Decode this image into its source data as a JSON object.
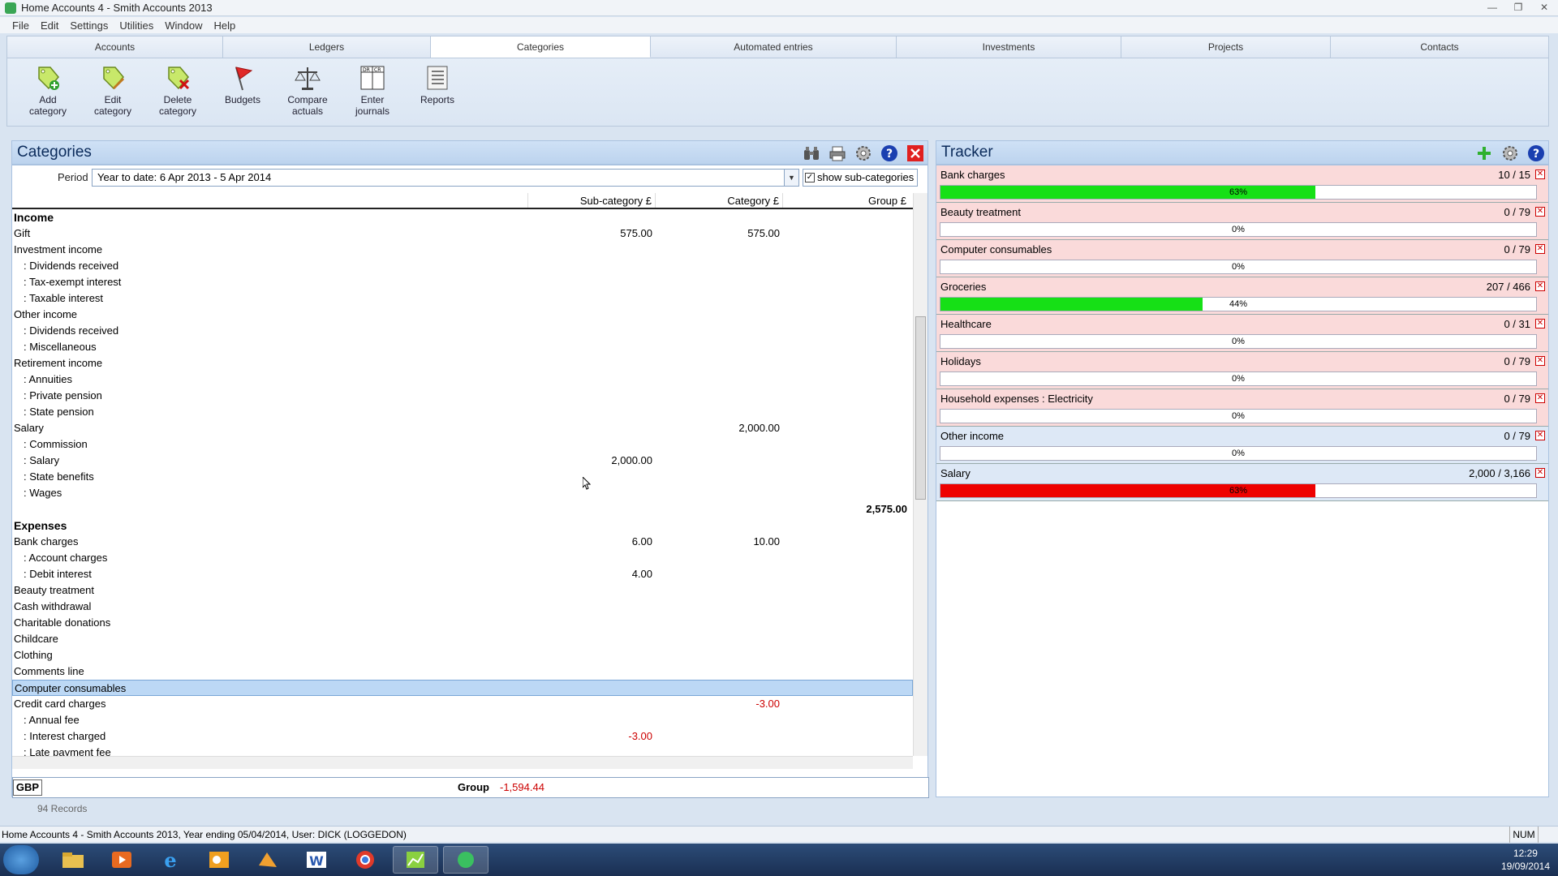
{
  "window": {
    "title": "Home Accounts 4 - Smith Accounts 2013"
  },
  "menu": [
    "File",
    "Edit",
    "Settings",
    "Utilities",
    "Window",
    "Help"
  ],
  "tabs": [
    {
      "label": "Accounts",
      "active": false
    },
    {
      "label": "Ledgers",
      "active": false
    },
    {
      "label": "Categories",
      "active": true
    },
    {
      "label": "Automated entries",
      "active": false
    },
    {
      "label": "Investments",
      "active": false
    },
    {
      "label": "Projects",
      "active": false
    },
    {
      "label": "Contacts",
      "active": false
    }
  ],
  "tools": [
    {
      "line1": "Add",
      "line2": "category",
      "icon": "add-tag-icon"
    },
    {
      "line1": "Edit",
      "line2": "category",
      "icon": "edit-tag-icon"
    },
    {
      "line1": "Delete",
      "line2": "category",
      "icon": "delete-tag-icon"
    },
    {
      "line1": "Budgets",
      "line2": "",
      "icon": "flag-icon"
    },
    {
      "line1": "Compare",
      "line2": "actuals",
      "icon": "scales-icon"
    },
    {
      "line1": "Enter",
      "line2": "journals",
      "icon": "journal-icon"
    },
    {
      "line1": "Reports",
      "line2": "",
      "icon": "report-icon"
    }
  ],
  "categories": {
    "title": "Categories",
    "period_label": "Period",
    "period_value": "Year to date: 6 Apr 2013 - 5 Apr 2014",
    "show_sub_label": "show sub-categories",
    "show_sub_checked": true,
    "columns": [
      "Sub-category £",
      "Category £",
      "Group £"
    ],
    "rows": [
      {
        "name": "Income",
        "type": "section",
        "sub": "",
        "cat": "",
        "grp": ""
      },
      {
        "name": "Gift",
        "type": "cat",
        "sub": "575.00",
        "cat": "575.00",
        "grp": ""
      },
      {
        "name": "Investment income",
        "type": "cat",
        "sub": "",
        "cat": "",
        "grp": ""
      },
      {
        "name": ": Dividends received",
        "type": "sub",
        "sub": "",
        "cat": "",
        "grp": ""
      },
      {
        "name": ": Tax-exempt interest",
        "type": "sub",
        "sub": "",
        "cat": "",
        "grp": ""
      },
      {
        "name": ": Taxable interest",
        "type": "sub",
        "sub": "",
        "cat": "",
        "grp": ""
      },
      {
        "name": "Other income",
        "type": "cat",
        "sub": "",
        "cat": "",
        "grp": ""
      },
      {
        "name": ": Dividends received",
        "type": "sub",
        "sub": "",
        "cat": "",
        "grp": ""
      },
      {
        "name": ": Miscellaneous",
        "type": "sub",
        "sub": "",
        "cat": "",
        "grp": ""
      },
      {
        "name": "Retirement income",
        "type": "cat",
        "sub": "",
        "cat": "",
        "grp": ""
      },
      {
        "name": ": Annuities",
        "type": "sub",
        "sub": "",
        "cat": "",
        "grp": ""
      },
      {
        "name": ": Private pension",
        "type": "sub",
        "sub": "",
        "cat": "",
        "grp": ""
      },
      {
        "name": ": State pension",
        "type": "sub",
        "sub": "",
        "cat": "",
        "grp": ""
      },
      {
        "name": "Salary",
        "type": "cat",
        "sub": "",
        "cat": "2,000.00",
        "grp": ""
      },
      {
        "name": ": Commission",
        "type": "sub",
        "sub": "",
        "cat": "",
        "grp": ""
      },
      {
        "name": ": Salary",
        "type": "sub",
        "sub": "2,000.00",
        "cat": "",
        "grp": ""
      },
      {
        "name": ": State benefits",
        "type": "sub",
        "sub": "",
        "cat": "",
        "grp": ""
      },
      {
        "name": ": Wages",
        "type": "sub",
        "sub": "",
        "cat": "",
        "grp": ""
      },
      {
        "name": "",
        "type": "total",
        "sub": "",
        "cat": "",
        "grp": "2,575.00"
      },
      {
        "name": "Expenses",
        "type": "section",
        "sub": "",
        "cat": "",
        "grp": ""
      },
      {
        "name": "Bank charges",
        "type": "cat",
        "sub": "6.00",
        "cat": "10.00",
        "grp": ""
      },
      {
        "name": ": Account charges",
        "type": "sub",
        "sub": "",
        "cat": "",
        "grp": ""
      },
      {
        "name": ": Debit interest",
        "type": "sub",
        "sub": "4.00",
        "cat": "",
        "grp": ""
      },
      {
        "name": "Beauty treatment",
        "type": "cat",
        "sub": "",
        "cat": "",
        "grp": ""
      },
      {
        "name": "Cash withdrawal",
        "type": "cat",
        "sub": "",
        "cat": "",
        "grp": ""
      },
      {
        "name": "Charitable donations",
        "type": "cat",
        "sub": "",
        "cat": "",
        "grp": ""
      },
      {
        "name": "Childcare",
        "type": "cat",
        "sub": "",
        "cat": "",
        "grp": ""
      },
      {
        "name": "Clothing",
        "type": "cat",
        "sub": "",
        "cat": "",
        "grp": ""
      },
      {
        "name": "Comments line",
        "type": "cat",
        "sub": "",
        "cat": "",
        "grp": ""
      },
      {
        "name": "Computer consumables",
        "type": "selected",
        "sub": "",
        "cat": "",
        "grp": ""
      },
      {
        "name": "Credit card charges",
        "type": "cat",
        "sub": "",
        "cat": "-3.00",
        "grp": ""
      },
      {
        "name": ": Annual fee",
        "type": "sub",
        "sub": "",
        "cat": "",
        "grp": ""
      },
      {
        "name": ": Interest charged",
        "type": "sub",
        "sub": "-3.00",
        "cat": "",
        "grp": ""
      },
      {
        "name": ": Late payment fee",
        "type": "sub",
        "sub": "",
        "cat": "",
        "grp": ""
      }
    ],
    "currency": "GBP",
    "group_label": "Group",
    "group_value": "-1,594.44",
    "records": "94 Records"
  },
  "tracker": {
    "title": "Tracker",
    "items": [
      {
        "name": "Bank charges",
        "value": "10 / 15",
        "pct_label": "63%",
        "fill": 0.63,
        "bg": "pink",
        "color": "#16e016"
      },
      {
        "name": "Beauty treatment",
        "value": "0 / 79",
        "pct_label": "0%",
        "fill": 0,
        "bg": "pink",
        "color": "#16e016"
      },
      {
        "name": "Computer consumables",
        "value": "0 / 79",
        "pct_label": "0%",
        "fill": 0,
        "bg": "pink",
        "color": "#16e016"
      },
      {
        "name": "Groceries",
        "value": "207 / 466",
        "pct_label": "44%",
        "fill": 0.44,
        "bg": "pink",
        "color": "#16e016"
      },
      {
        "name": "Healthcare",
        "value": "0 / 31",
        "pct_label": "0%",
        "fill": 0,
        "bg": "pink",
        "color": "#16e016"
      },
      {
        "name": "Holidays",
        "value": "0 / 79",
        "pct_label": "0%",
        "fill": 0,
        "bg": "pink",
        "color": "#16e016"
      },
      {
        "name": "Household expenses : Electricity",
        "value": "0 / 79",
        "pct_label": "0%",
        "fill": 0,
        "bg": "pink",
        "color": "#16e016"
      },
      {
        "name": "Other income",
        "value": "0 / 79",
        "pct_label": "0%",
        "fill": 0,
        "bg": "blue",
        "color": "#16e016"
      },
      {
        "name": "Salary",
        "value": "2,000 / 3,166",
        "pct_label": "63%",
        "fill": 0.63,
        "bg": "blue",
        "color": "#ee0000"
      }
    ]
  },
  "status": {
    "text": "Home Accounts 4 - Smith Accounts 2013, Year ending 05/04/2014, User: DICK (LOGGEDON)",
    "num": "NUM"
  },
  "clock": {
    "time": "12:29",
    "date": "19/09/2014"
  }
}
